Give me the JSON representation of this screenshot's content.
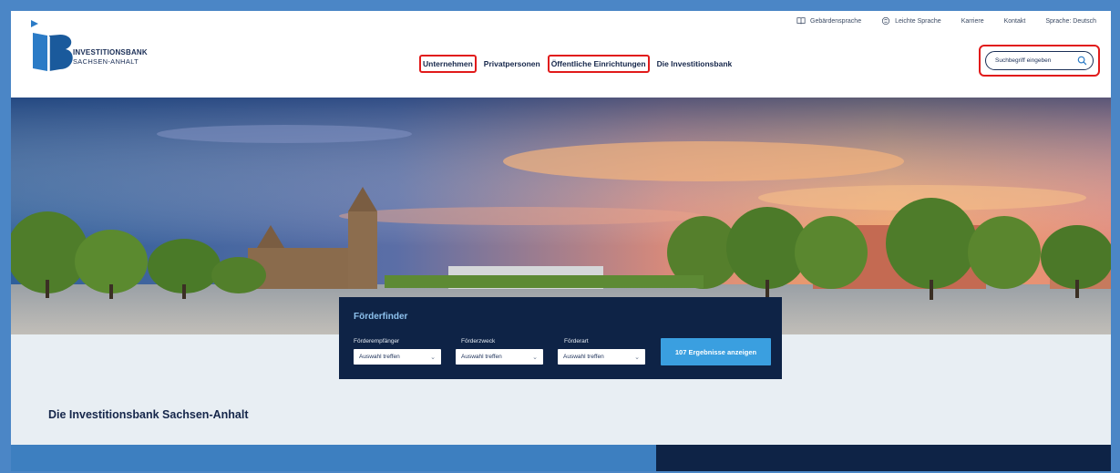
{
  "logo": {
    "line1": "INVESTITIONSBANK",
    "line2": "SACHSEN-ANHALT"
  },
  "util_nav": [
    {
      "label": "Gebärdensprache",
      "icon": "book-icon"
    },
    {
      "label": "Leichte Sprache",
      "icon": "easy-language-icon"
    },
    {
      "label": "Karriere"
    },
    {
      "label": "Kontakt"
    },
    {
      "label": "Sprache: Deutsch"
    }
  ],
  "main_nav": [
    {
      "label": "Unternehmen"
    },
    {
      "label": "Privatpersonen"
    },
    {
      "label": "Öffentliche Einrichtungen"
    },
    {
      "label": "Die Investitionsbank"
    }
  ],
  "search": {
    "placeholder": "Suchbegriff eingeben",
    "icon": "search-icon"
  },
  "finder": {
    "title": "Förderfinder",
    "fields": [
      {
        "label": "Förderempfänger",
        "value": "Auswahl treffen"
      },
      {
        "label": "Förderzweck",
        "value": "Auswahl treffen"
      },
      {
        "label": "Förderart",
        "value": "Auswahl treffen"
      }
    ],
    "button": "107 Ergebnisse anzeigen"
  },
  "section_title": "Die Investitionsbank Sachsen-Anhalt",
  "colors": {
    "navy": "#0e2346",
    "accent_blue": "#3a9fe0",
    "highlight_red": "#e11a1a",
    "band_blue": "#3d7fc0"
  }
}
